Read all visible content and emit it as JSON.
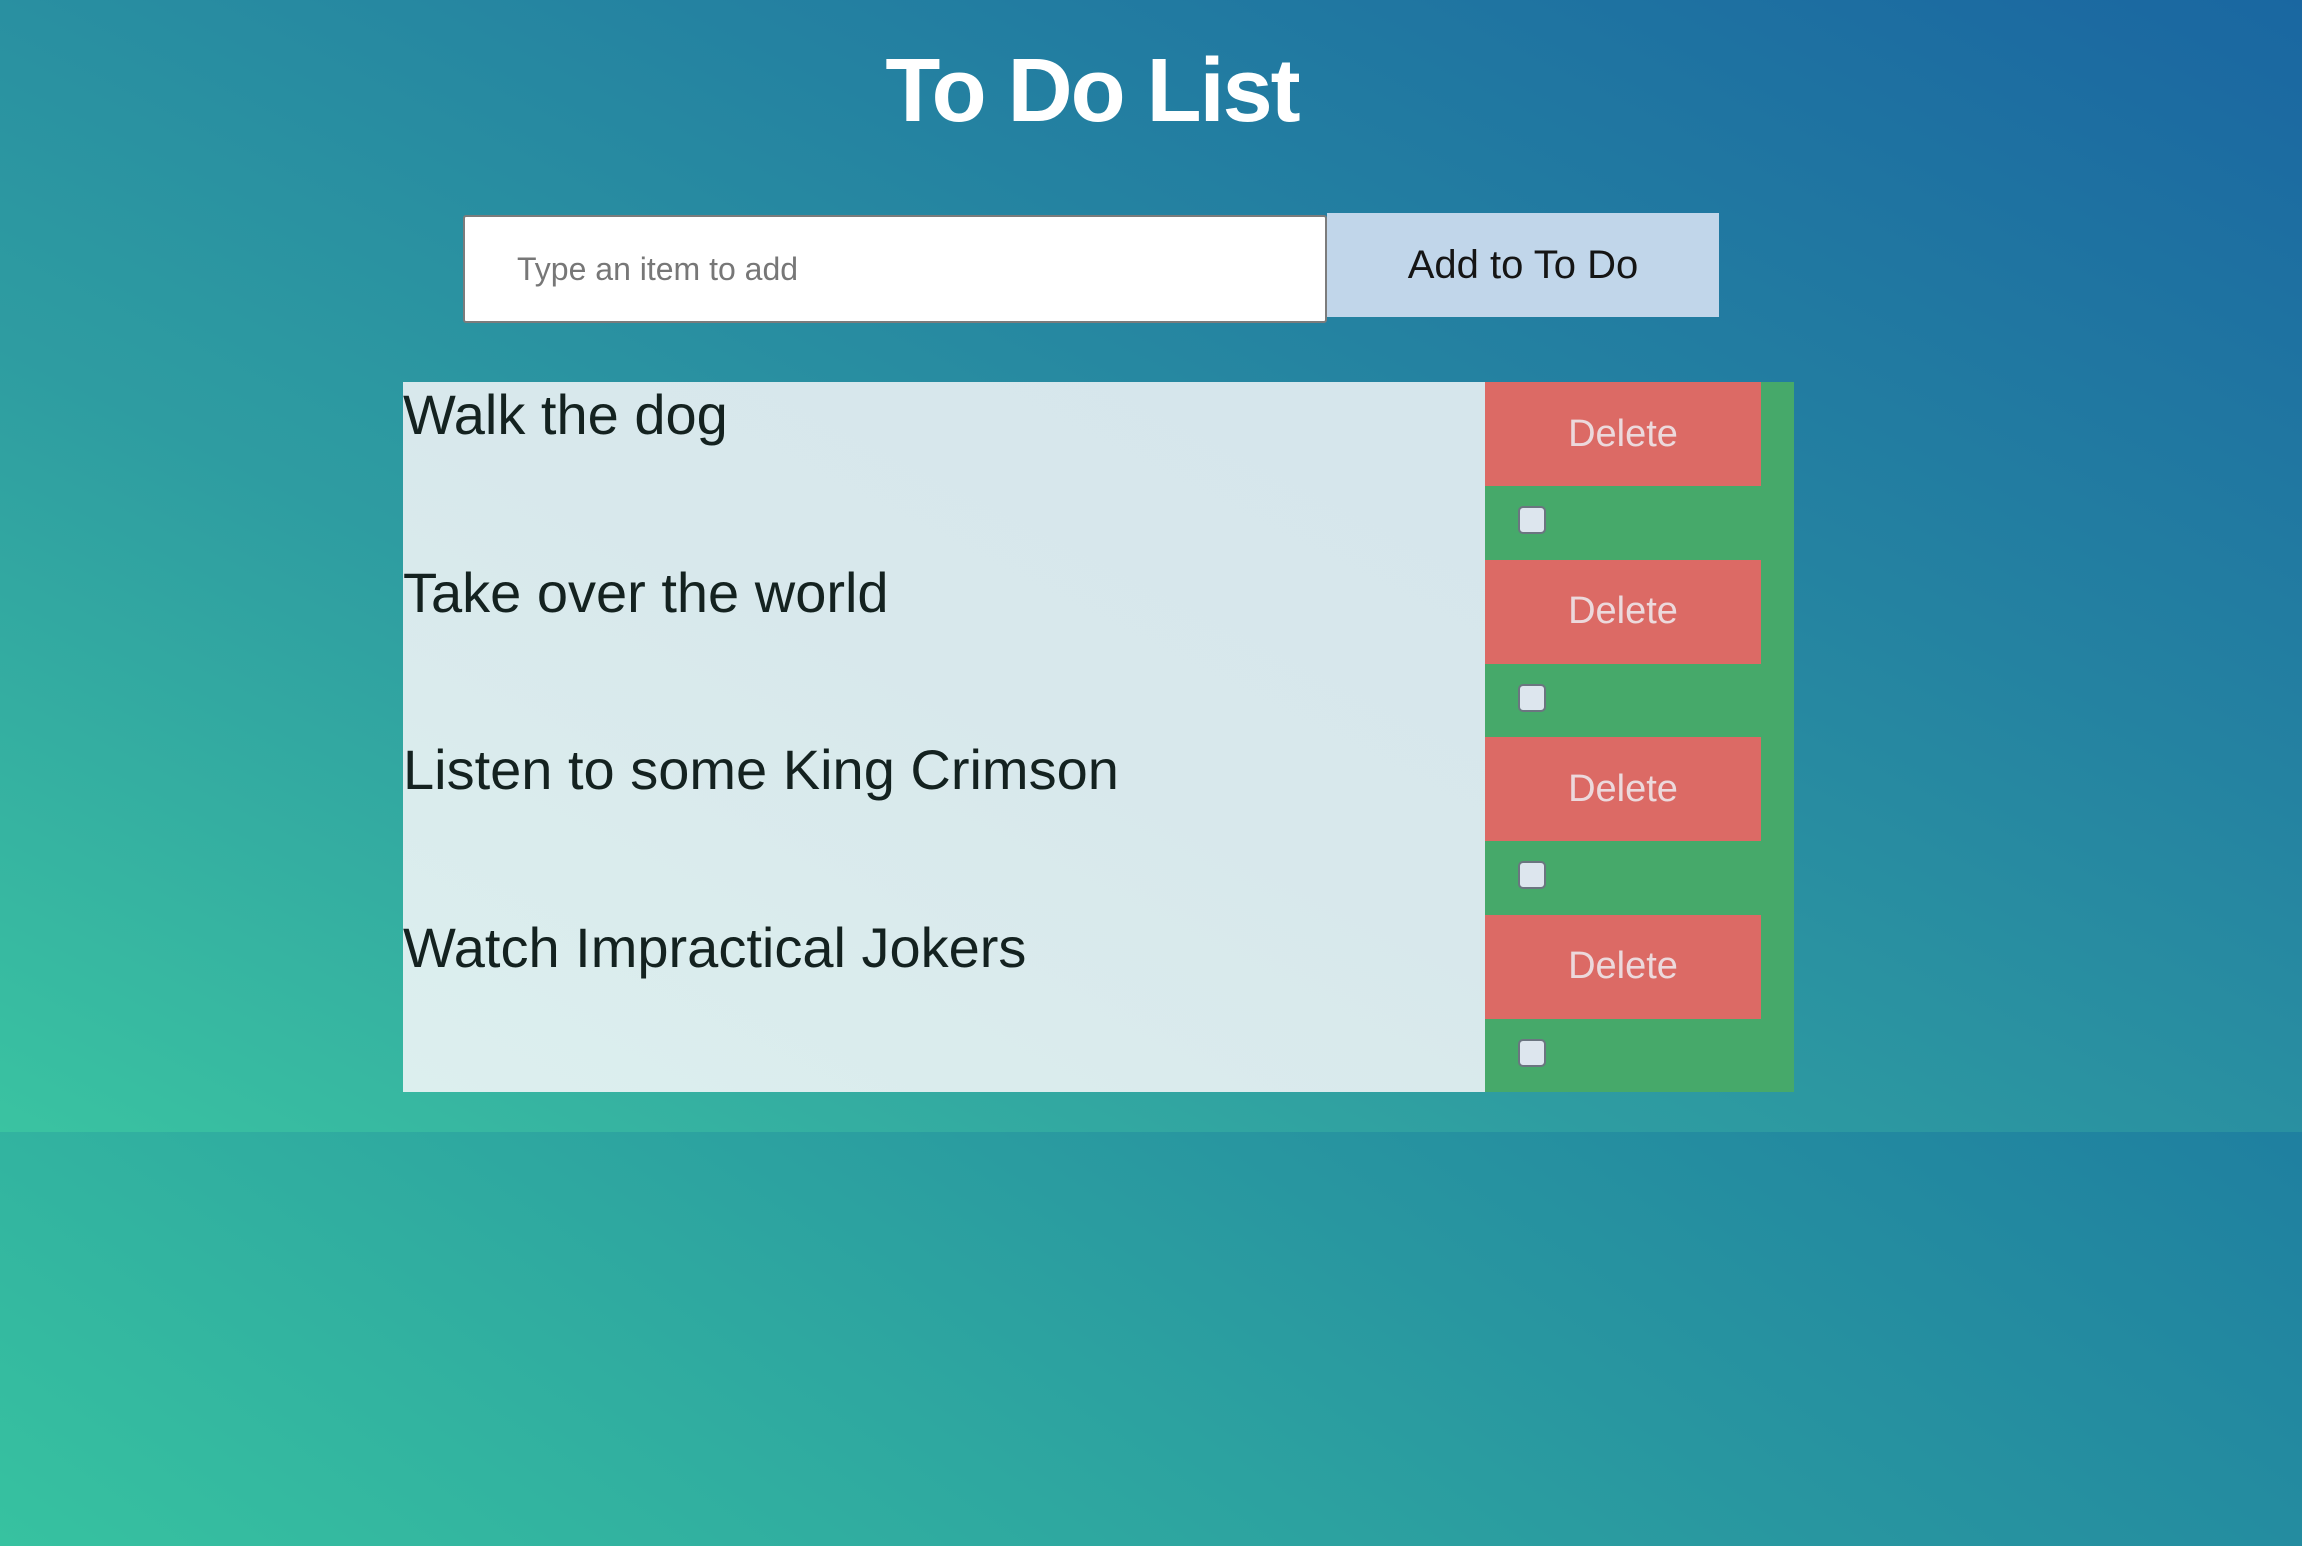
{
  "header": {
    "title": "To Do List"
  },
  "add_form": {
    "placeholder": "Type an item to add",
    "button_label": "Add to To Do"
  },
  "todos": [
    {
      "text": "Walk the dog",
      "delete_label": "Delete",
      "done": false
    },
    {
      "text": "Take over the world",
      "delete_label": "Delete",
      "done": false
    },
    {
      "text": "Listen to some King Crimson",
      "delete_label": "Delete",
      "done": false
    },
    {
      "text": "Watch Impractical Jokers",
      "delete_label": "Delete",
      "done": false
    }
  ],
  "colors": {
    "gradient_start": "#37c2a0",
    "gradient_end": "#1664a0",
    "add_button": "#c0d6ea",
    "delete_button": "#dc6a65",
    "action_column": "#43a868",
    "list_background": "#d8e8ec"
  }
}
